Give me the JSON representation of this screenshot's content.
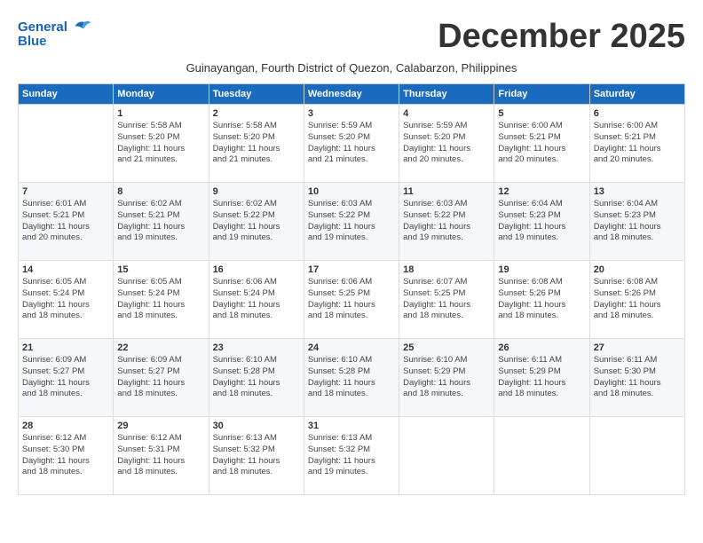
{
  "logo": {
    "line1": "General",
    "line2": "Blue"
  },
  "title": "December 2025",
  "subtitle": "Guinayangan, Fourth District of Quezon, Calabarzon, Philippines",
  "days_of_week": [
    "Sunday",
    "Monday",
    "Tuesday",
    "Wednesday",
    "Thursday",
    "Friday",
    "Saturday"
  ],
  "weeks": [
    [
      {
        "day": "",
        "info": ""
      },
      {
        "day": "1",
        "info": "Sunrise: 5:58 AM\nSunset: 5:20 PM\nDaylight: 11 hours\nand 21 minutes."
      },
      {
        "day": "2",
        "info": "Sunrise: 5:58 AM\nSunset: 5:20 PM\nDaylight: 11 hours\nand 21 minutes."
      },
      {
        "day": "3",
        "info": "Sunrise: 5:59 AM\nSunset: 5:20 PM\nDaylight: 11 hours\nand 21 minutes."
      },
      {
        "day": "4",
        "info": "Sunrise: 5:59 AM\nSunset: 5:20 PM\nDaylight: 11 hours\nand 20 minutes."
      },
      {
        "day": "5",
        "info": "Sunrise: 6:00 AM\nSunset: 5:21 PM\nDaylight: 11 hours\nand 20 minutes."
      },
      {
        "day": "6",
        "info": "Sunrise: 6:00 AM\nSunset: 5:21 PM\nDaylight: 11 hours\nand 20 minutes."
      }
    ],
    [
      {
        "day": "7",
        "info": "Sunrise: 6:01 AM\nSunset: 5:21 PM\nDaylight: 11 hours\nand 20 minutes."
      },
      {
        "day": "8",
        "info": "Sunrise: 6:02 AM\nSunset: 5:21 PM\nDaylight: 11 hours\nand 19 minutes."
      },
      {
        "day": "9",
        "info": "Sunrise: 6:02 AM\nSunset: 5:22 PM\nDaylight: 11 hours\nand 19 minutes."
      },
      {
        "day": "10",
        "info": "Sunrise: 6:03 AM\nSunset: 5:22 PM\nDaylight: 11 hours\nand 19 minutes."
      },
      {
        "day": "11",
        "info": "Sunrise: 6:03 AM\nSunset: 5:22 PM\nDaylight: 11 hours\nand 19 minutes."
      },
      {
        "day": "12",
        "info": "Sunrise: 6:04 AM\nSunset: 5:23 PM\nDaylight: 11 hours\nand 19 minutes."
      },
      {
        "day": "13",
        "info": "Sunrise: 6:04 AM\nSunset: 5:23 PM\nDaylight: 11 hours\nand 18 minutes."
      }
    ],
    [
      {
        "day": "14",
        "info": "Sunrise: 6:05 AM\nSunset: 5:24 PM\nDaylight: 11 hours\nand 18 minutes."
      },
      {
        "day": "15",
        "info": "Sunrise: 6:05 AM\nSunset: 5:24 PM\nDaylight: 11 hours\nand 18 minutes."
      },
      {
        "day": "16",
        "info": "Sunrise: 6:06 AM\nSunset: 5:24 PM\nDaylight: 11 hours\nand 18 minutes."
      },
      {
        "day": "17",
        "info": "Sunrise: 6:06 AM\nSunset: 5:25 PM\nDaylight: 11 hours\nand 18 minutes."
      },
      {
        "day": "18",
        "info": "Sunrise: 6:07 AM\nSunset: 5:25 PM\nDaylight: 11 hours\nand 18 minutes."
      },
      {
        "day": "19",
        "info": "Sunrise: 6:08 AM\nSunset: 5:26 PM\nDaylight: 11 hours\nand 18 minutes."
      },
      {
        "day": "20",
        "info": "Sunrise: 6:08 AM\nSunset: 5:26 PM\nDaylight: 11 hours\nand 18 minutes."
      }
    ],
    [
      {
        "day": "21",
        "info": "Sunrise: 6:09 AM\nSunset: 5:27 PM\nDaylight: 11 hours\nand 18 minutes."
      },
      {
        "day": "22",
        "info": "Sunrise: 6:09 AM\nSunset: 5:27 PM\nDaylight: 11 hours\nand 18 minutes."
      },
      {
        "day": "23",
        "info": "Sunrise: 6:10 AM\nSunset: 5:28 PM\nDaylight: 11 hours\nand 18 minutes."
      },
      {
        "day": "24",
        "info": "Sunrise: 6:10 AM\nSunset: 5:28 PM\nDaylight: 11 hours\nand 18 minutes."
      },
      {
        "day": "25",
        "info": "Sunrise: 6:10 AM\nSunset: 5:29 PM\nDaylight: 11 hours\nand 18 minutes."
      },
      {
        "day": "26",
        "info": "Sunrise: 6:11 AM\nSunset: 5:29 PM\nDaylight: 11 hours\nand 18 minutes."
      },
      {
        "day": "27",
        "info": "Sunrise: 6:11 AM\nSunset: 5:30 PM\nDaylight: 11 hours\nand 18 minutes."
      }
    ],
    [
      {
        "day": "28",
        "info": "Sunrise: 6:12 AM\nSunset: 5:30 PM\nDaylight: 11 hours\nand 18 minutes."
      },
      {
        "day": "29",
        "info": "Sunrise: 6:12 AM\nSunset: 5:31 PM\nDaylight: 11 hours\nand 18 minutes."
      },
      {
        "day": "30",
        "info": "Sunrise: 6:13 AM\nSunset: 5:32 PM\nDaylight: 11 hours\nand 18 minutes."
      },
      {
        "day": "31",
        "info": "Sunrise: 6:13 AM\nSunset: 5:32 PM\nDaylight: 11 hours\nand 19 minutes."
      },
      {
        "day": "",
        "info": ""
      },
      {
        "day": "",
        "info": ""
      },
      {
        "day": "",
        "info": ""
      }
    ]
  ]
}
